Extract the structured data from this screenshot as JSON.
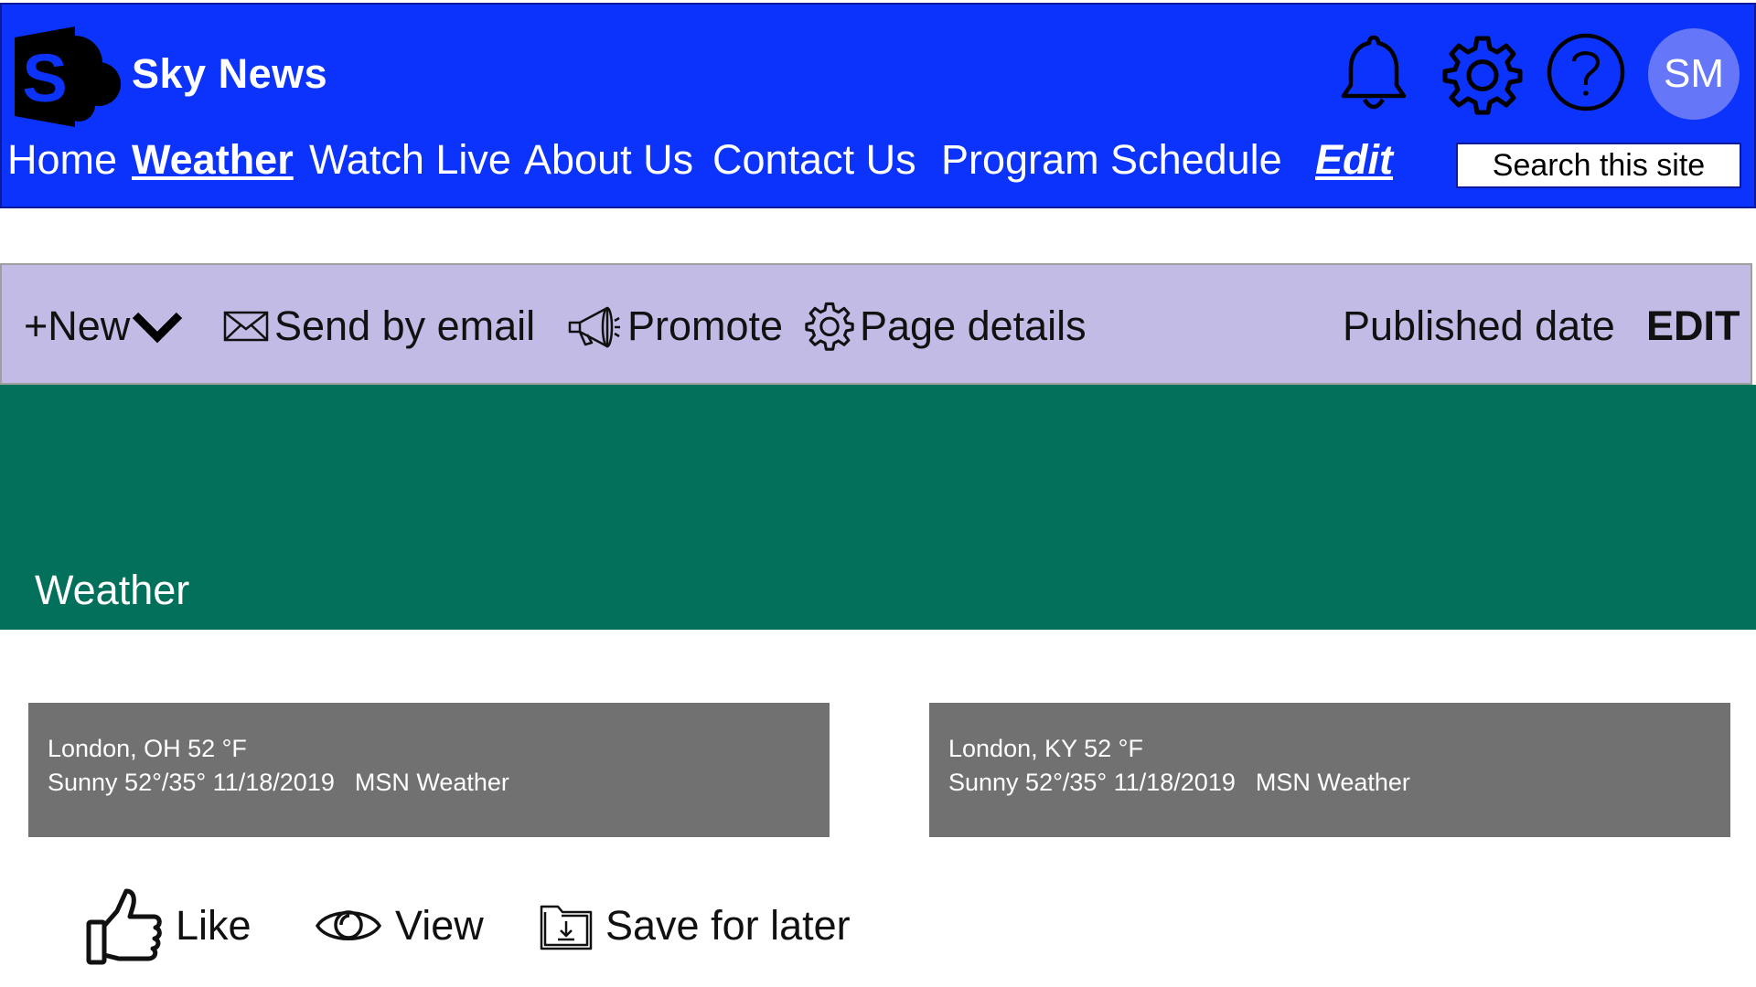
{
  "header": {
    "site_title": "Sky News",
    "background_color": "#0c33fc",
    "logo_icon": "sharepoint-logo",
    "nav": [
      {
        "label": "Home"
      },
      {
        "label": "Weather",
        "active": true
      },
      {
        "label": "Watch Live"
      },
      {
        "label": "About Us"
      },
      {
        "label": "Contact Us"
      },
      {
        "label": "Program Schedule"
      }
    ],
    "edit_label": "Edit",
    "search_placeholder": "Search this site",
    "icons": [
      "bell-icon",
      "gear-icon",
      "help-icon"
    ],
    "avatar_initials": "SM",
    "avatar_color": "#6676f8"
  },
  "command_bar": {
    "background_color": "#c1bbe5",
    "new_label": "+New",
    "send_email_label": "Send by email",
    "promote_label": "Promote",
    "page_details_label": "Page details",
    "published_date_label": "Published date",
    "edit_label": "EDIT"
  },
  "hero": {
    "title": "Weather",
    "background_color": "#03705c"
  },
  "weather_cards": [
    {
      "location_line": "London, OH 52 °F",
      "condition": "Sunny 52°/35° 11/18/2019",
      "source": "MSN Weather"
    },
    {
      "location_line": "London, KY 52 °F",
      "condition": "Sunny 52°/35° 11/18/2019",
      "source": "MSN Weather"
    }
  ],
  "actions": {
    "like_label": "Like",
    "view_label": "View",
    "save_label": "Save for later"
  }
}
